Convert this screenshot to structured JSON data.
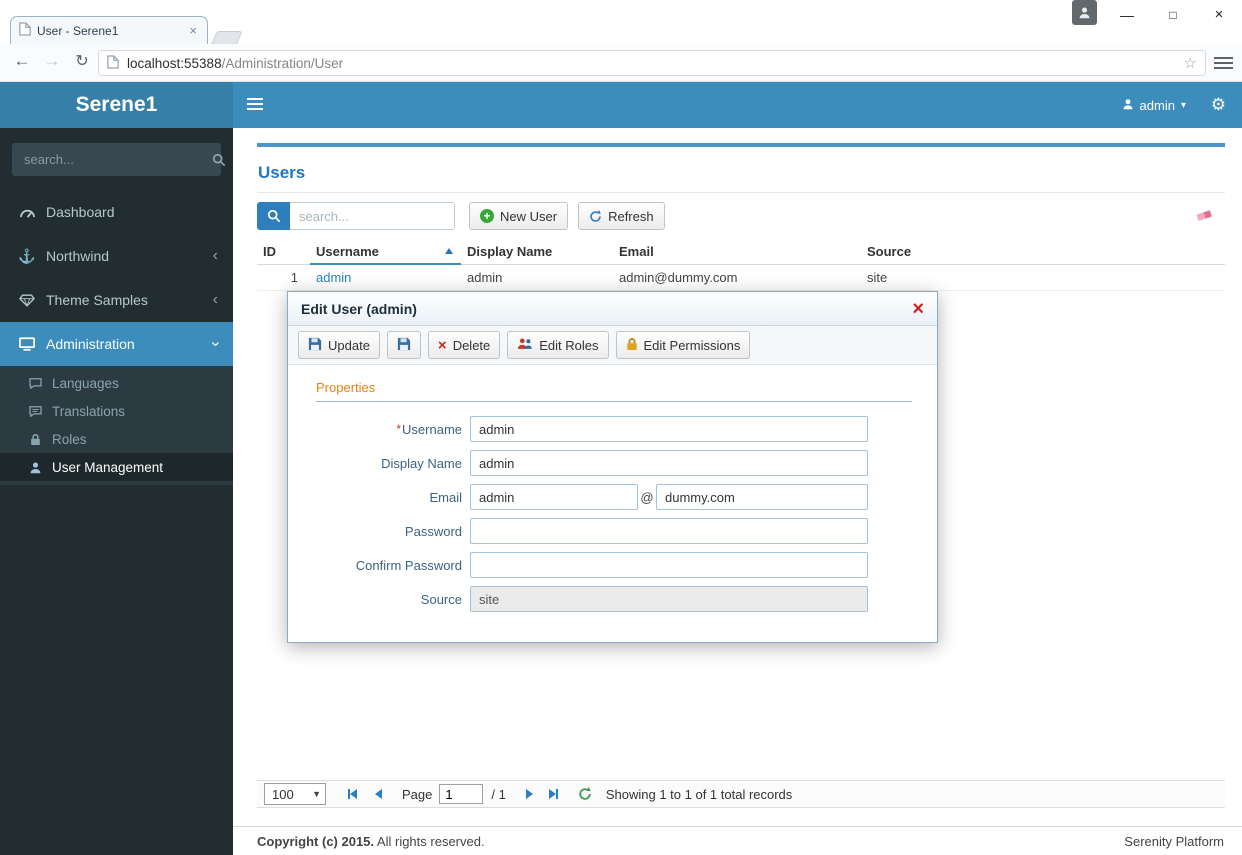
{
  "browser": {
    "tab_title": "User - Serene1",
    "url_host": "localhost:55388",
    "url_path": "/Administration/User"
  },
  "icons": {
    "back": "←",
    "forward": "→",
    "reload": "↻",
    "star": "☆",
    "minimize": "—",
    "maximize": "□",
    "close": "×",
    "tab_close": "×",
    "dialog_close": "×",
    "delete_x": "×",
    "gear": "⚙",
    "anchor": "⚓",
    "caret_down": "▾",
    "chevron": "‹",
    "plus": "+",
    "select_caret": "▼"
  },
  "app": {
    "brand": "Serene1",
    "user": "admin"
  },
  "sidebar": {
    "search_placeholder": "search...",
    "items": [
      {
        "label": "Dashboard"
      },
      {
        "label": "Northwind"
      },
      {
        "label": "Theme Samples"
      },
      {
        "label": "Administration"
      }
    ],
    "subitems": [
      {
        "label": "Languages"
      },
      {
        "label": "Translations"
      },
      {
        "label": "Roles"
      },
      {
        "label": "User Management"
      }
    ]
  },
  "page": {
    "title": "Users",
    "search_placeholder": "search...",
    "buttons": {
      "new_user": "New User",
      "refresh": "Refresh"
    },
    "grid": {
      "columns": [
        "ID",
        "Username",
        "Display Name",
        "Email",
        "Source"
      ],
      "row": {
        "id": "1",
        "username": "admin",
        "display_name": "admin",
        "email": "admin@dummy.com",
        "source": "site"
      }
    },
    "pager": {
      "size": "100",
      "page_label": "Page",
      "page": "1",
      "total_pages": "/ 1",
      "status": "Showing 1 to 1 of 1 total records"
    }
  },
  "dialog": {
    "title": "Edit User (admin)",
    "buttons": {
      "update": "Update",
      "delete": "Delete",
      "edit_roles": "Edit Roles",
      "edit_permissions": "Edit Permissions"
    },
    "category": "Properties",
    "fields": {
      "username": {
        "label": "Username",
        "required_marker": "*",
        "value": "admin"
      },
      "display_name": {
        "label": "Display Name",
        "value": "admin"
      },
      "email": {
        "label": "Email",
        "user": "admin",
        "at": "@",
        "domain": "dummy.com"
      },
      "password": {
        "label": "Password"
      },
      "confirm_password": {
        "label": "Confirm Password"
      },
      "source": {
        "label": "Source",
        "value": "site"
      }
    }
  },
  "footer": {
    "copyright_strong": "Copyright (c) 2015.",
    "copyright_rest": " All rights reserved.",
    "platform": "Serenity Platform"
  },
  "colors": {
    "header": "#3c8dbc",
    "brand": "#367fa9",
    "sidebar": "#222d32",
    "submenu": "#2c3b41",
    "category_orange": "#e8830d",
    "link": "#2a7fbe",
    "danger": "#cc2222",
    "success": "#35a835"
  }
}
